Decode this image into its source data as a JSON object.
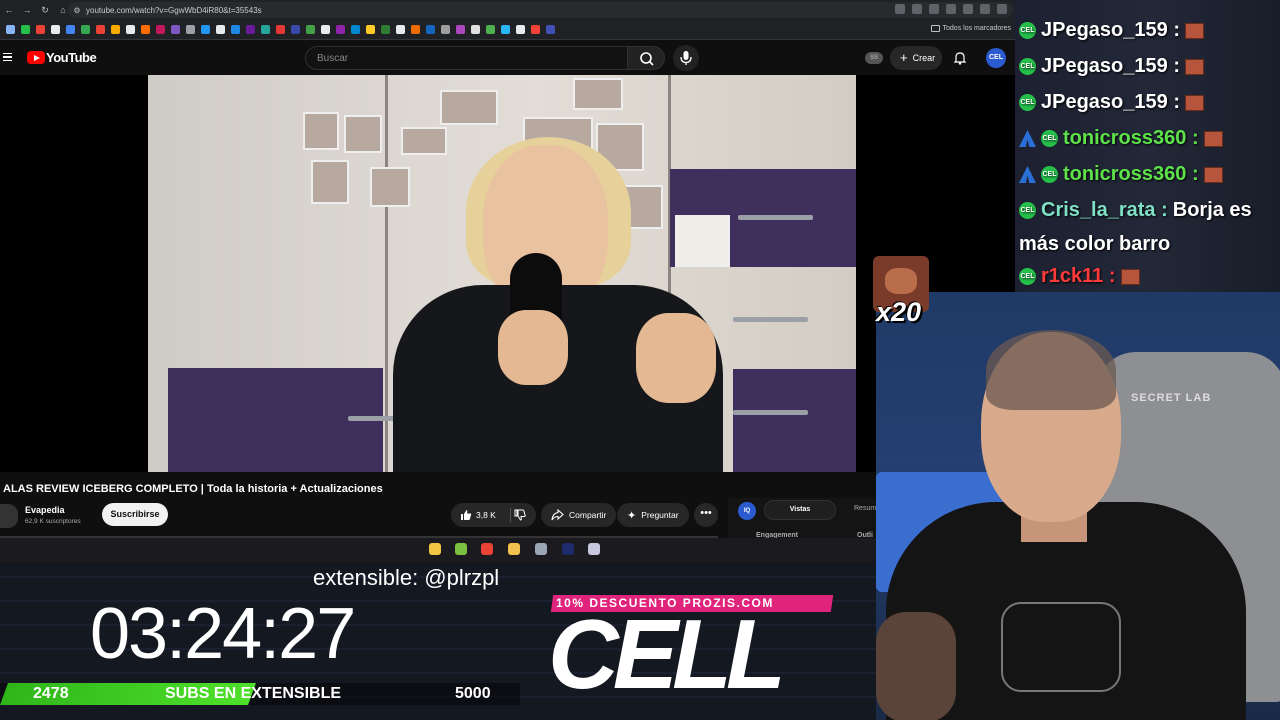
{
  "browser": {
    "url": "youtube.com/watch?v=GgwWbD4iR80&t=35543s",
    "bookmarks_label": "Todos los marcadores",
    "bookmark_colors": [
      "#8ab4f8",
      "#24c04a",
      "#ea4335",
      "#e8eaed",
      "#4285f4",
      "#34a853",
      "#ea4335",
      "#f9ab00",
      "#e8eaed",
      "#ff6d00",
      "#c2185b",
      "#7e57c2",
      "#9aa0a6",
      "#2196f3",
      "#e8eaed",
      "#1e88e5",
      "#6a1b9a",
      "#26a69a",
      "#e53935",
      "#3949ab",
      "#43a047",
      "#e8eaed",
      "#8e24aa",
      "#0288d1",
      "#ffca28",
      "#2e7d32",
      "#e8eaed",
      "#ef6c00",
      "#1565c0",
      "#9e9e9e",
      "#ab47bc",
      "#e0e0e0",
      "#4caf50",
      "#29b6f6",
      "#e8eaed",
      "#f44336",
      "#3f51b5"
    ]
  },
  "youtube": {
    "brand": "YouTube",
    "search_placeholder": "Buscar",
    "ss_badge": "SS",
    "create_label": "Crear",
    "avatar_text": "CEL",
    "video_title": "ALAS REVIEW ICEBERG COMPLETO | Toda la historia + Actualizaciones",
    "channel_name": "Evapedia",
    "channel_subs": "62,9 K suscriptores",
    "subscribe_label": "Suscribirse",
    "like_count": "3,8 K",
    "share_label": "Compartir",
    "ask_label": "Preguntar",
    "more_label": "•••",
    "side_panel": {
      "badge": "IQ",
      "tab_active": "Vistas",
      "tab_other": "Resum",
      "engagement": "Engagement",
      "outline": "Outli"
    }
  },
  "taskbar": {
    "icon_colors": [
      "#f4c542",
      "#7cc142",
      "#ea4335",
      "#f2c14e",
      "#9ba6b5",
      "#1f2a6b",
      "#c7c7e0"
    ]
  },
  "overlay": {
    "ticker": "extensible: @plrzpl",
    "timer": "03:24:27",
    "goal_current": "2478",
    "goal_label": "SUBS EN EXTENSIBLE",
    "goal_target": "5000",
    "goal_progress": 0.4956,
    "promo_text": "10% DESCUENTO PROZIS.COM",
    "promo_color": "#e0247c",
    "logo_text": "CELL",
    "emote_count": "x20"
  },
  "chat": {
    "messages": [
      {
        "user": "JPegaso_159",
        "color": "#ffffff",
        "badges": [
          "b"
        ],
        "sep": " :",
        "text": "",
        "emote": true
      },
      {
        "user": "JPegaso_159",
        "color": "#ffffff",
        "badges": [
          "b"
        ],
        "sep": " :",
        "text": "",
        "emote": true
      },
      {
        "user": "JPegaso_159",
        "color": "#ffffff",
        "badges": [
          "b"
        ],
        "sep": " :",
        "text": "",
        "emote": true
      },
      {
        "user": "tonicross360",
        "color": "#5de24a",
        "badges": [
          "prime",
          "b"
        ],
        "sep": " :",
        "text": "",
        "emote": true
      },
      {
        "user": "tonicross360",
        "color": "#5de24a",
        "badges": [
          "prime",
          "b"
        ],
        "sep": " :",
        "text": "",
        "emote": true
      },
      {
        "user": "Cris_la_rata",
        "color": "#7ee0c4",
        "badges": [
          "b"
        ],
        "sep": " :",
        "text": "Borja es",
        "emote": false
      },
      {
        "user": "",
        "color": "#ffffff",
        "badges": [],
        "sep": "",
        "text": "más color barro",
        "emote": false
      },
      {
        "user": "r1ck11",
        "color": "#ff3b3b",
        "badges": [
          "b"
        ],
        "sep": " :",
        "text": "",
        "emote": true
      }
    ],
    "badge_text": "CEL"
  },
  "webcam": {
    "chair_logo": "SECRET LAB"
  }
}
